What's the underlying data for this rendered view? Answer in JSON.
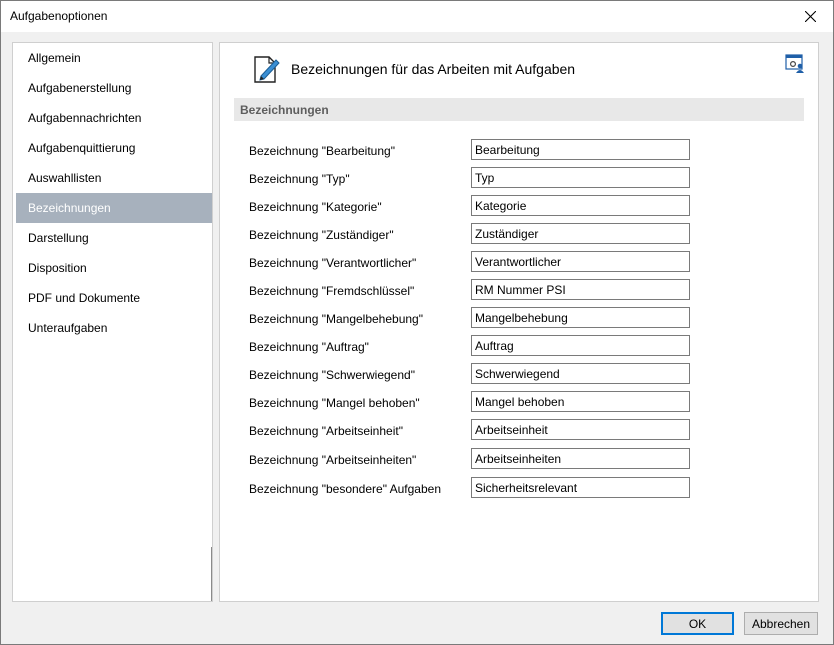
{
  "window": {
    "title": "Aufgabenoptionen"
  },
  "nav": {
    "items": [
      {
        "label": "Allgemein"
      },
      {
        "label": "Aufgabenerstellung"
      },
      {
        "label": "Aufgabennachrichten"
      },
      {
        "label": "Aufgabenquittierung"
      },
      {
        "label": "Auswahllisten"
      },
      {
        "label": "Bezeichnungen",
        "selected": true
      },
      {
        "label": "Darstellung"
      },
      {
        "label": "Disposition"
      },
      {
        "label": "PDF und Dokumente"
      },
      {
        "label": "Unteraufgaben"
      }
    ]
  },
  "content": {
    "header_title": "Bezeichnungen für das Arbeiten mit Aufgaben",
    "header_icon": "document-pen-icon",
    "settings_icon": "window-user-settings-icon",
    "section_title": "Bezeichnungen",
    "rows": [
      {
        "label": "Bezeichnung \"Bearbeitung\"",
        "value": "Bearbeitung"
      },
      {
        "label": "Bezeichnung \"Typ\"",
        "value": "Typ"
      },
      {
        "label": "Bezeichnung \"Kategorie\"",
        "value": "Kategorie"
      },
      {
        "label": "Bezeichnung \"Zuständiger\"",
        "value": "Zuständiger"
      },
      {
        "label": "Bezeichnung \"Verantwortlicher\"",
        "value": "Verantwortlicher"
      },
      {
        "label": "Bezeichnung \"Fremdschlüssel\"",
        "value": "RM Nummer PSI"
      },
      {
        "label": "Bezeichnung \"Mangelbehebung\"",
        "value": "Mangelbehebung"
      },
      {
        "label": "Bezeichnung \"Auftrag\"",
        "value": "Auftrag"
      },
      {
        "label": "Bezeichnung \"Schwerwiegend\"",
        "value": "Schwerwiegend"
      },
      {
        "label": "Bezeichnung \"Mangel behoben\"",
        "value": "Mangel behoben"
      },
      {
        "label": "Bezeichnung \"Arbeitseinheit\"",
        "value": "Arbeitseinheit"
      },
      {
        "label": "Bezeichnung \"Arbeitseinheiten\"",
        "value": "Arbeitseinheiten"
      },
      {
        "label": "Bezeichnung \"besondere\" Aufgaben",
        "value": "Sicherheitsrelevant"
      }
    ]
  },
  "buttons": {
    "ok": "OK",
    "cancel": "Abbrechen"
  },
  "colors": {
    "selection": "#a7b1bd",
    "default_button_border": "#0078d7"
  }
}
